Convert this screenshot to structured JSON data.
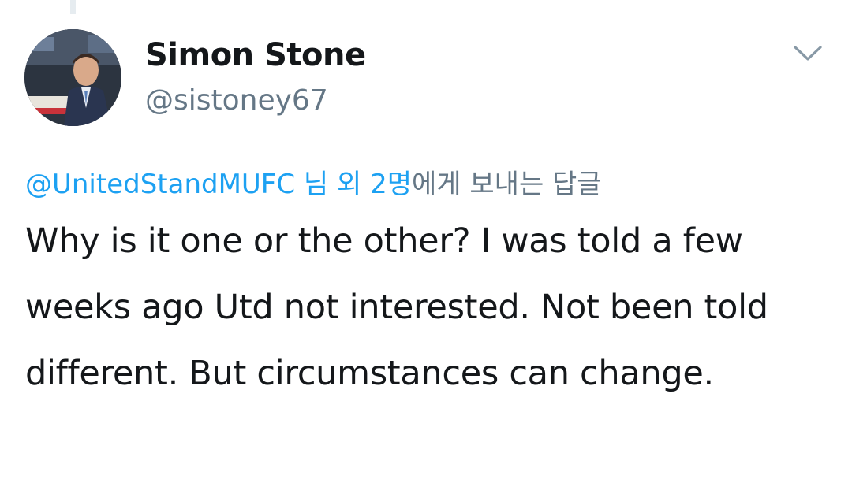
{
  "tweet": {
    "user": {
      "display_name": "Simon Stone",
      "handle": "@sistoney67",
      "avatar_icon": "profile-photo"
    },
    "menu_icon": "chevron-down-icon",
    "reply": {
      "mentions": "@UnitedStandMUFC 님 외 2명",
      "suffix": "에게 보내는 답글"
    },
    "text": "Why is it one or the other? I was told a few weeks ago Utd not interested. Not been told different. But circumstances can change."
  },
  "colors": {
    "link": "#1da1f2",
    "primary_text": "#14171a",
    "secondary_text": "#657786",
    "thread_line": "#e6ecf0"
  }
}
